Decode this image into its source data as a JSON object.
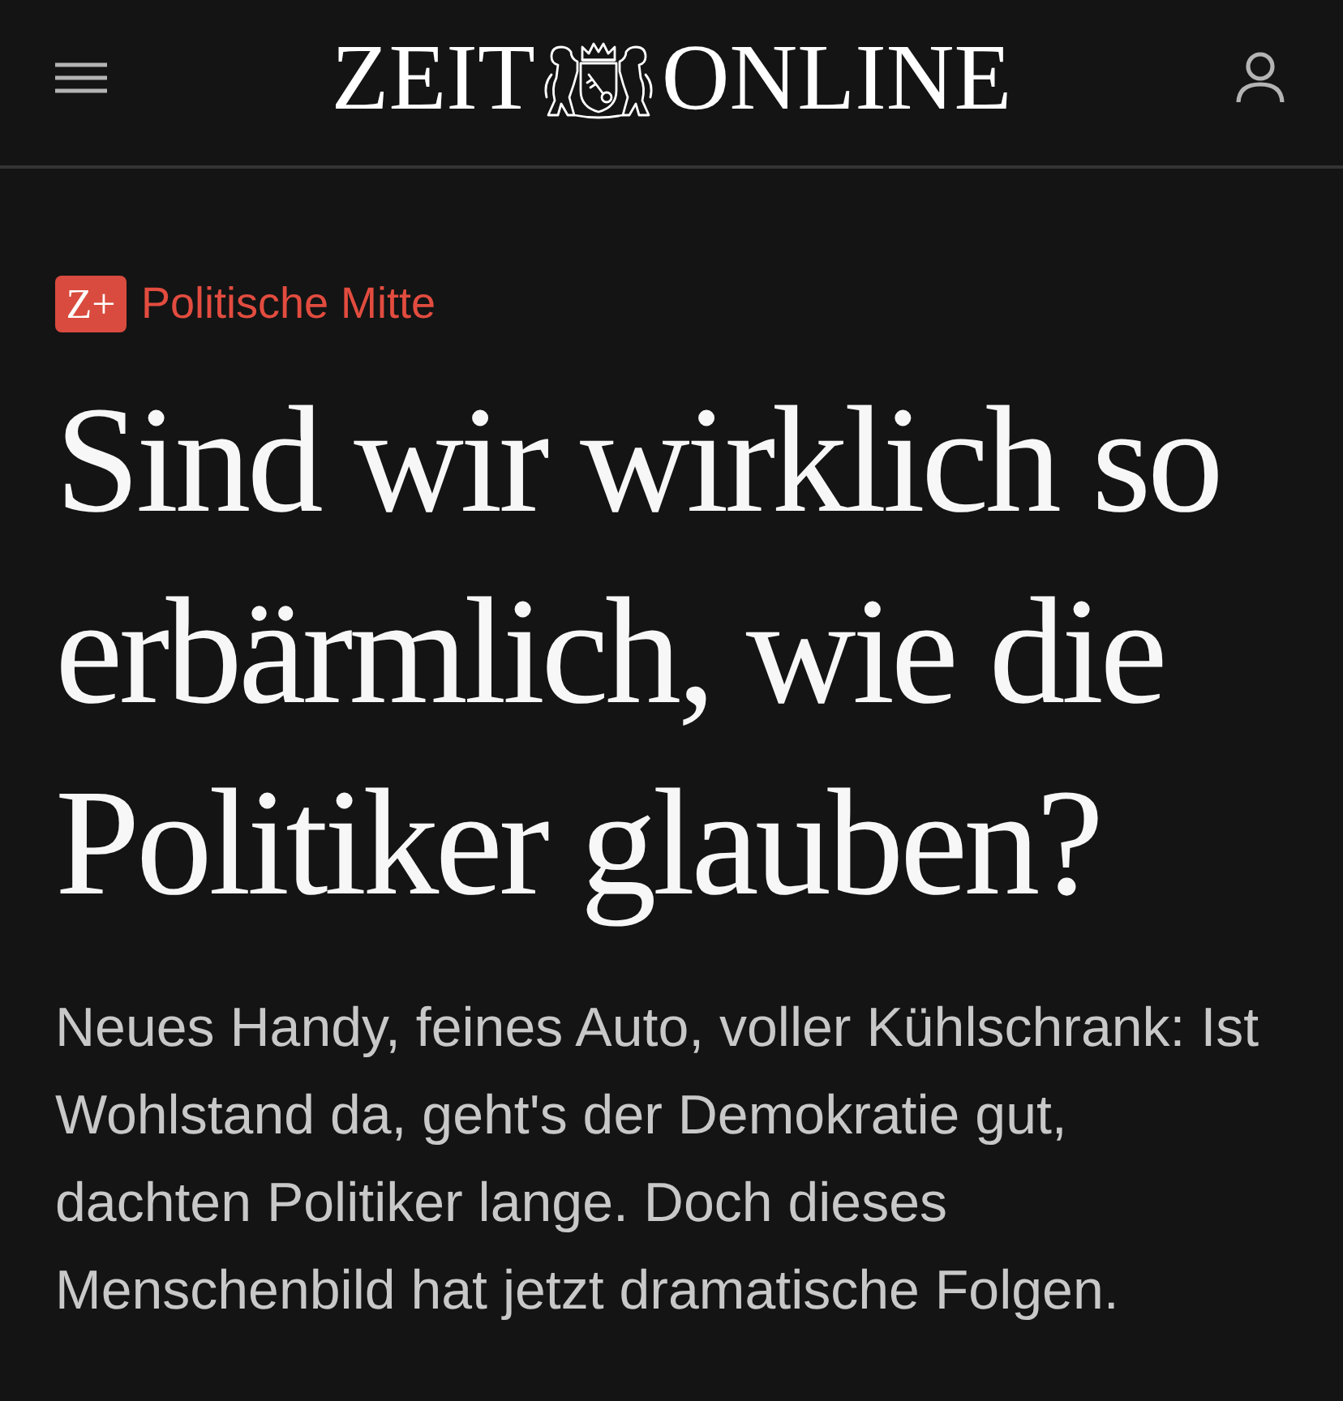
{
  "header": {
    "logo": {
      "left": "ZEIT",
      "right": "ONLINE"
    }
  },
  "article": {
    "kicker": {
      "badge": "Z+",
      "label": "Politische Mitte"
    },
    "headline": "Sind wir wirklich so erbärmlich, wie die Politiker glauben?",
    "teaser": "Neues Handy, feines Auto, voller Kühlschrank: Ist Wohlstand da, geht's der Demokratie gut, dachten Politiker lange. Doch dieses Menschenbild hat jetzt dramatische Folgen."
  }
}
